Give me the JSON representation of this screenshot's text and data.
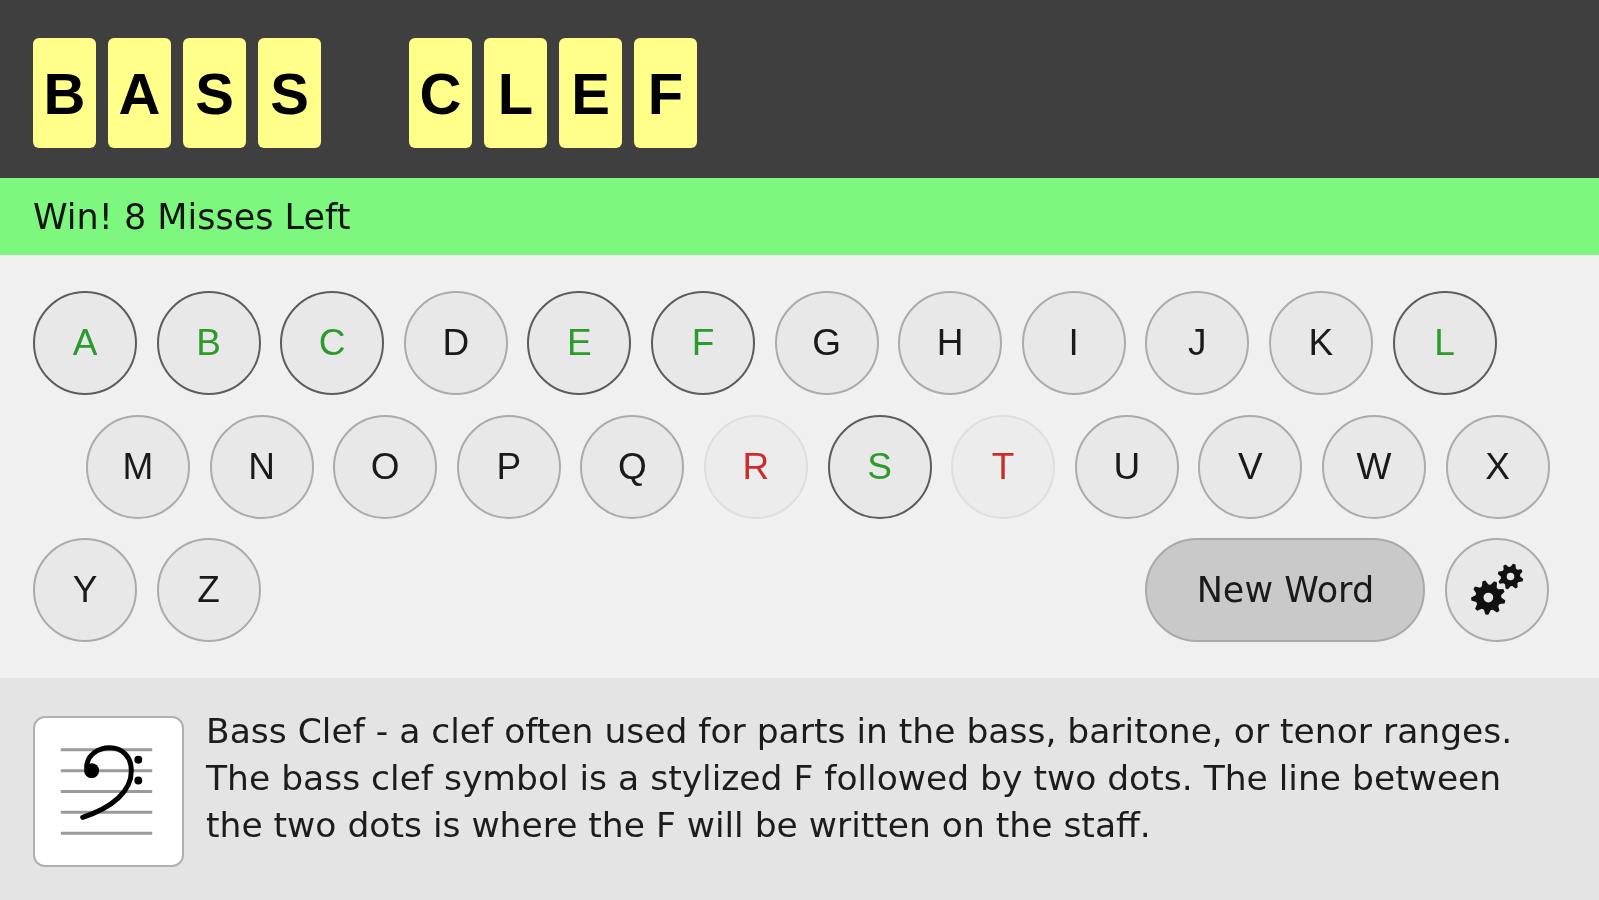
{
  "puzzle": {
    "words": [
      [
        "B",
        "A",
        "S",
        "S"
      ],
      [
        "C",
        "L",
        "E",
        "F"
      ]
    ]
  },
  "status": {
    "text": "Win! 8 Misses Left",
    "won": true
  },
  "keyboard": {
    "rows": [
      [
        {
          "label": "A",
          "hit": true,
          "miss": false
        },
        {
          "label": "B",
          "hit": true,
          "miss": false
        },
        {
          "label": "C",
          "hit": true,
          "miss": false
        },
        {
          "label": "D",
          "hit": false,
          "miss": false
        },
        {
          "label": "E",
          "hit": true,
          "miss": false
        },
        {
          "label": "F",
          "hit": true,
          "miss": false
        },
        {
          "label": "G",
          "hit": false,
          "miss": false
        },
        {
          "label": "H",
          "hit": false,
          "miss": false
        },
        {
          "label": "I",
          "hit": false,
          "miss": false
        },
        {
          "label": "J",
          "hit": false,
          "miss": false
        },
        {
          "label": "K",
          "hit": false,
          "miss": false
        },
        {
          "label": "L",
          "hit": true,
          "miss": false
        }
      ],
      [
        {
          "label": "M",
          "hit": false,
          "miss": false
        },
        {
          "label": "N",
          "hit": false,
          "miss": false
        },
        {
          "label": "O",
          "hit": false,
          "miss": false
        },
        {
          "label": "P",
          "hit": false,
          "miss": false
        },
        {
          "label": "Q",
          "hit": false,
          "miss": false
        },
        {
          "label": "R",
          "hit": false,
          "miss": true
        },
        {
          "label": "S",
          "hit": true,
          "miss": false
        },
        {
          "label": "T",
          "hit": false,
          "miss": true
        },
        {
          "label": "U",
          "hit": false,
          "miss": false
        },
        {
          "label": "V",
          "hit": false,
          "miss": false
        },
        {
          "label": "W",
          "hit": false,
          "miss": false
        },
        {
          "label": "X",
          "hit": false,
          "miss": false
        }
      ],
      [
        {
          "label": "Y",
          "hit": false,
          "miss": false
        },
        {
          "label": "Z",
          "hit": false,
          "miss": false
        }
      ]
    ],
    "new_word_button": "New Word"
  },
  "info": {
    "text": "Bass Clef - a clef often used for parts in the bass, baritone, or tenor ranges. The bass clef symbol is a stylized F followed by two dots. The line between the two dots is where the F will be written on the staff."
  }
}
